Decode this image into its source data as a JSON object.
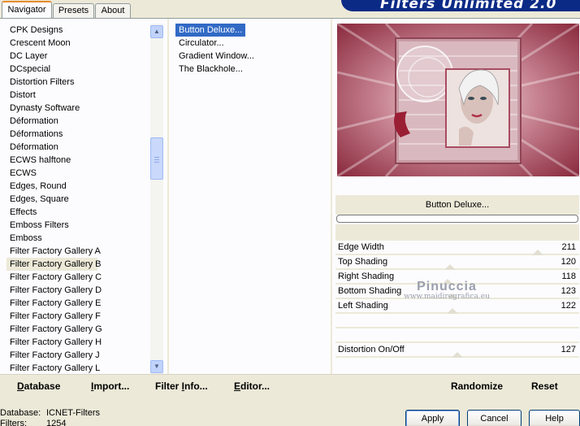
{
  "tabs": [
    "Navigator",
    "Presets",
    "About"
  ],
  "banner_title": "Filters Unlimited 2.0",
  "categories": [
    "CPK Designs",
    "Crescent Moon",
    "DC Layer",
    "DCspecial",
    "Distortion Filters",
    "Distort",
    "Dynasty Software",
    "Déformation",
    "Déformations",
    "Déformation",
    "ECWS halftone",
    "ECWS",
    "Edges, Round",
    "Edges, Square",
    "Effects",
    "Emboss Filters",
    "Emboss",
    "Filter Factory Gallery A",
    "Filter Factory Gallery B",
    "Filter Factory Gallery C",
    "Filter Factory Gallery D",
    "Filter Factory Gallery E",
    "Filter Factory Gallery F",
    "Filter Factory Gallery G",
    "Filter Factory Gallery H",
    "Filter Factory Gallery J",
    "Filter Factory Gallery L"
  ],
  "selected_category": "Filter Factory Gallery B",
  "filters": [
    "Button Deluxe...",
    "Circulator...",
    "Gradient Window...",
    "The Blackhole..."
  ],
  "selected_filter": "Button Deluxe...",
  "preview_filter_name": "Button Deluxe...",
  "parameters": [
    {
      "name": "Edge Width",
      "value": "211",
      "level": 0.83
    },
    {
      "name": "Top Shading",
      "value": "120",
      "level": 0.47
    },
    {
      "name": "Right Shading",
      "value": "118",
      "level": 0.46
    },
    {
      "name": "Bottom Shading",
      "value": "123",
      "level": 0.48
    },
    {
      "name": "Left Shading",
      "value": "122",
      "level": 0.48
    },
    {
      "name": "",
      "value": "",
      "level": null
    },
    {
      "name": "",
      "value": "",
      "level": null
    },
    {
      "name": "Distortion On/Off",
      "value": "127",
      "level": 0.5
    }
  ],
  "watermark": {
    "line1": "Pinuccia",
    "line2": "www.maidiregrafica.eu"
  },
  "bottom_buttons": {
    "database": {
      "u": "D",
      "rest": "atabase"
    },
    "import": {
      "u": "I",
      "rest": "mport..."
    },
    "filter_info": {
      "pre": "Filter ",
      "u": "I",
      "rest": "nfo..."
    },
    "editor": {
      "u": "E",
      "rest": "ditor..."
    },
    "randomize": "Randomize",
    "reset": "Reset"
  },
  "status": {
    "database_label": "Database:",
    "database_value": "ICNET-Filters",
    "filters_label": "Filters:",
    "filters_value": "1254"
  },
  "dialog_buttons": {
    "apply": "Apply",
    "cancel": "Cancel",
    "help": "Help"
  },
  "colors": {
    "selection": "#316ac5",
    "panel": "#ece9d8",
    "banner": "#0b2a86",
    "active_tab_accent": "#e68b2c"
  }
}
